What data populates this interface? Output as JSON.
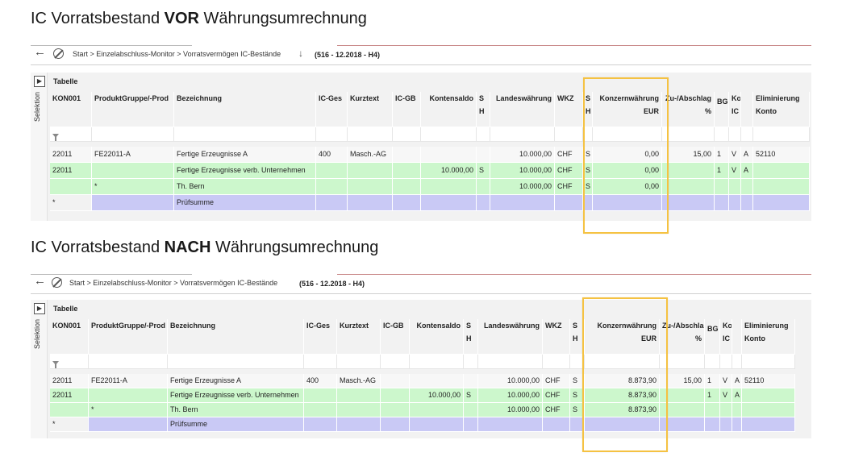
{
  "colors": {
    "green_row": "#ccf7cc",
    "sum_row": "#c9c9f5",
    "highlight": "#f5c242"
  },
  "icons": [
    "back-arrow-icon",
    "cancel-icon",
    "down-arrow-icon",
    "selection-toggle-icon",
    "filter-icon"
  ],
  "sections": [
    {
      "heading_pre": "IC Vorratsbestand ",
      "heading_bold": "VOR",
      "heading_post": " Währungsumrechnung",
      "breadcrumb": "Start > Einzelabschluss-Monitor > Vorratsvermögen IC-Bestände",
      "period": "(516 - 12.2018 - H4)",
      "side_label": "Selektion",
      "table_title": "Tabelle",
      "columns": [
        {
          "h1": "KON001",
          "h2": ""
        },
        {
          "h1": "ProduktGruppe/-Prod",
          "h2": ""
        },
        {
          "h1": "Bezeichnung",
          "h2": ""
        },
        {
          "h1": "IC-Ges",
          "h2": ""
        },
        {
          "h1": "Kurztext",
          "h2": ""
        },
        {
          "h1": "IC-GB",
          "h2": ""
        },
        {
          "h1": "Kontensaldo",
          "h2": ""
        },
        {
          "h1": "S",
          "h2": "H"
        },
        {
          "h1": "Landeswährung",
          "h2": ""
        },
        {
          "h1": "WKZ",
          "h2": ""
        },
        {
          "h1": "S",
          "h2": "H"
        },
        {
          "h1": "Konzernwährung",
          "h2": "EUR"
        },
        {
          "h1": "Zu-/Abschlag",
          "h2": "%"
        },
        {
          "h1": "",
          "h2": "BG"
        },
        {
          "h1": "Konto",
          "h2": "IC"
        },
        {
          "h1": "",
          "h2": ""
        },
        {
          "h1": "Eliminierung",
          "h2": "Konto"
        }
      ],
      "rows": [
        {
          "style": "white",
          "cells": [
            "22011",
            "FE22011-A",
            "Fertige Erzeugnisse A",
            "400",
            "Masch.-AG",
            "",
            "",
            "",
            "10.000,00",
            "CHF",
            "S",
            "0,00",
            "15,00",
            "1",
            "V",
            "A",
            "52110"
          ]
        },
        {
          "style": "green",
          "cells": [
            "22011",
            "",
            "Fertige Erzeugnisse verb. Unternehmen",
            "",
            "",
            "",
            "10.000,00",
            "S",
            "10.000,00",
            "CHF",
            "S",
            "0,00",
            "",
            "1",
            "V",
            "A",
            ""
          ]
        },
        {
          "style": "green",
          "cells": [
            "",
            "*",
            "Th. Bern",
            "",
            "",
            "",
            "",
            "",
            "10.000,00",
            "CHF",
            "S",
            "0,00",
            "",
            "",
            "",
            "",
            ""
          ]
        },
        {
          "style": "sum",
          "cells": [
            "*",
            "",
            "Prüfsumme",
            "",
            "",
            "",
            "",
            "",
            "",
            "",
            "",
            "",
            "",
            "",
            "",
            "",
            ""
          ]
        }
      ]
    },
    {
      "heading_pre": "IC Vorratsbestand ",
      "heading_bold": "NACH",
      "heading_post": " Währungsumrechnung",
      "breadcrumb": "Start > Einzelabschluss-Monitor > Vorratsvermögen IC-Bestände",
      "period": "(516 - 12.2018 - H4)",
      "side_label": "Selektion",
      "table_title": "Tabelle",
      "columns": [
        {
          "h1": "KON001",
          "h2": ""
        },
        {
          "h1": "ProduktGruppe/-Prod",
          "h2": ""
        },
        {
          "h1": "Bezeichnung",
          "h2": ""
        },
        {
          "h1": "IC-Ges",
          "h2": ""
        },
        {
          "h1": "Kurztext",
          "h2": ""
        },
        {
          "h1": "IC-GB",
          "h2": ""
        },
        {
          "h1": "Kontensaldo",
          "h2": ""
        },
        {
          "h1": "S",
          "h2": "H"
        },
        {
          "h1": "Landeswährung",
          "h2": ""
        },
        {
          "h1": "WKZ",
          "h2": ""
        },
        {
          "h1": "S",
          "h2": "H"
        },
        {
          "h1": "Konzernwährung",
          "h2": "EUR"
        },
        {
          "h1": "Zu-/Abschlag",
          "h2": "%"
        },
        {
          "h1": "",
          "h2": "BG"
        },
        {
          "h1": "Konto",
          "h2": "IC"
        },
        {
          "h1": "",
          "h2": ""
        },
        {
          "h1": "Eliminierung",
          "h2": "Konto"
        }
      ],
      "rows": [
        {
          "style": "white",
          "cells": [
            "22011",
            "FE22011-A",
            "Fertige Erzeugnisse A",
            "400",
            "Masch.-AG",
            "",
            "",
            "",
            "10.000,00",
            "CHF",
            "S",
            "8.873,90",
            "15,00",
            "1",
            "V",
            "A",
            "52110"
          ]
        },
        {
          "style": "green",
          "cells": [
            "22011",
            "",
            "Fertige Erzeugnisse verb. Unternehmen",
            "",
            "",
            "",
            "10.000,00",
            "S",
            "10.000,00",
            "CHF",
            "S",
            "8.873,90",
            "",
            "1",
            "V",
            "A",
            ""
          ]
        },
        {
          "style": "green",
          "cells": [
            "",
            "*",
            "Th. Bern",
            "",
            "",
            "",
            "",
            "",
            "10.000,00",
            "CHF",
            "S",
            "8.873,90",
            "",
            "",
            "",
            "",
            ""
          ]
        },
        {
          "style": "sum",
          "cells": [
            "*",
            "",
            "Prüfsumme",
            "",
            "",
            "",
            "",
            "",
            "",
            "",
            "",
            "",
            "",
            "",
            "",
            "",
            ""
          ]
        }
      ]
    }
  ]
}
